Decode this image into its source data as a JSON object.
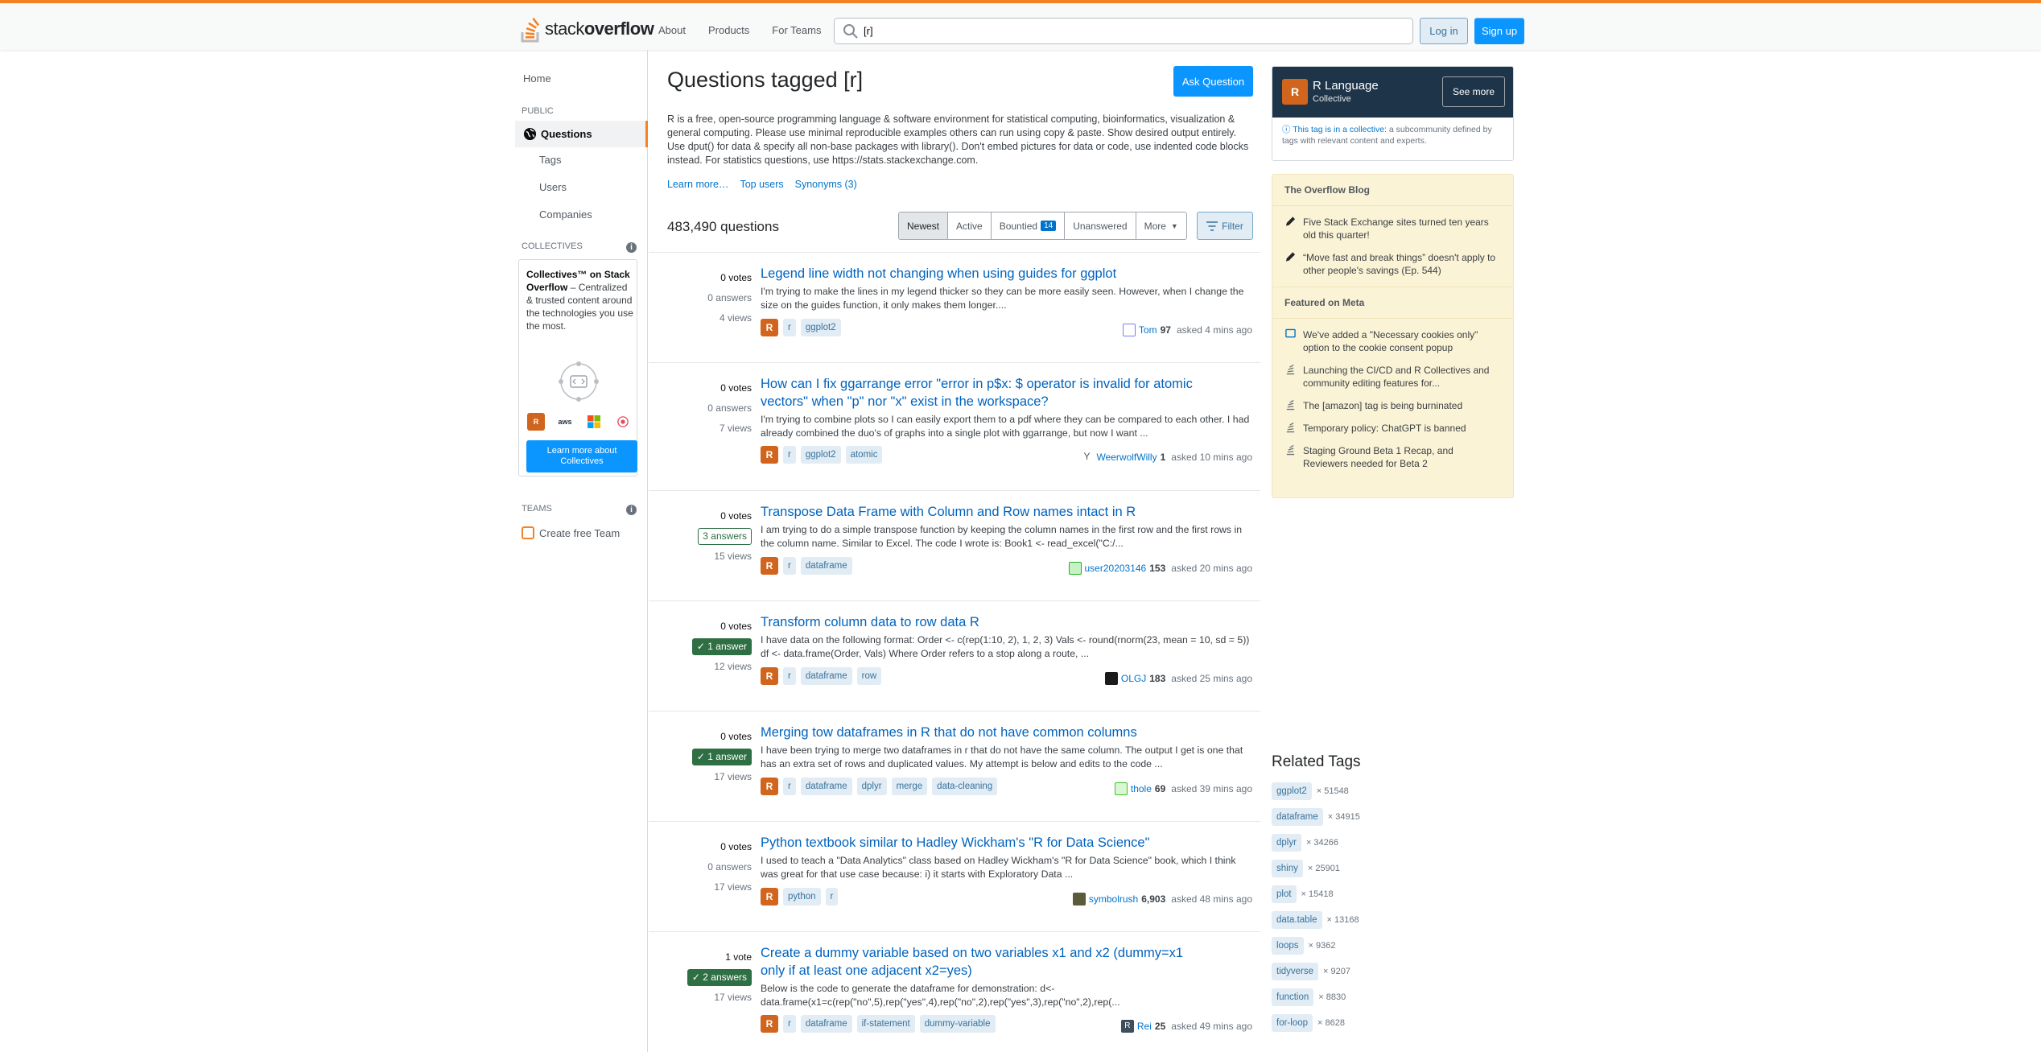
{
  "header": {
    "logo_stack": "stack",
    "logo_overflow": "overflow",
    "nav": [
      "About",
      "Products",
      "For Teams"
    ],
    "search_value": "[r]",
    "login": "Log in",
    "signup": "Sign up",
    "accent_color": "#f48225"
  },
  "leftnav": {
    "home": "Home",
    "public_label": "PUBLIC",
    "questions": "Questions",
    "tags": "Tags",
    "users": "Users",
    "companies": "Companies",
    "collectives_label": "COLLECTIVES",
    "collectives_title": "Collectives™ on Stack Overflow",
    "collectives_text": " – Centralized & trusted content around the technologies you use the most.",
    "collectives_btn": "Learn more about Collectives",
    "teams_label": "TEAMS",
    "create_team": "Create free Team"
  },
  "main": {
    "title": "Questions tagged [r]",
    "ask": "Ask Question",
    "description": "R is a free, open-source programming language & software environment for statistical computing, bioinformatics, visualization & general computing. Please use minimal reproducible examples others can run using copy & paste. Show desired output entirely. Use dput() for data & specify all non-base packages with library(). Don't embed pictures for data or code, use indented code blocks instead. For statistics questions, use https://stats.stackexchange.com.",
    "links": [
      "Learn more…",
      "Top users",
      "Synonyms (3)"
    ],
    "count": "483,490 questions",
    "sort": {
      "newest": "Newest",
      "active": "Active",
      "bountied": "Bountied",
      "bountied_count": "14",
      "unanswered": "Unanswered",
      "more": "More"
    },
    "filter": "Filter"
  },
  "questions": [
    {
      "votes": "0 votes",
      "answers": "0 answers",
      "views": "4 views",
      "title": "Legend line width not changing when using guides for ggplot",
      "excerpt": "I'm trying to make the lines in my legend thicker so they can be more easily seen. However, when I change the size on the guides function, it only makes them longer....",
      "tags": [
        "r",
        "ggplot2"
      ],
      "user": "Tom",
      "rep": "97",
      "time": "asked 4 mins ago"
    },
    {
      "votes": "0 votes",
      "answers": "0 answers",
      "views": "7 views",
      "title": "How can I fix ggarrange error \"error in p$x: $ operator is invalid for atomic vectors\" when \"p\" nor \"x\" exist in the workspace?",
      "excerpt": "I'm trying to combine plots so I can easily export them to a pdf where they can be compared to each other. I had already combined the duo's of graphs into a single plot with ggarrange, but now I want ...",
      "tags": [
        "r",
        "ggplot2",
        "atomic"
      ],
      "user": "WeerwolfWilly",
      "rep": "1",
      "time": "asked 10 mins ago"
    },
    {
      "votes": "0 votes",
      "answers": "3 answers",
      "views": "15 views",
      "title": "Transpose Data Frame with Column and Row names intact in R",
      "excerpt": "I am trying to do a simple transpose function by keeping the column names in the first row and the first rows in the column name. Similar to Excel. The code I wrote is: Book1 <- read_excel(\"C:/...",
      "tags": [
        "r",
        "dataframe"
      ],
      "user": "user20203146",
      "rep": "153",
      "time": "asked 20 mins ago"
    },
    {
      "votes": "0 votes",
      "answers": "1 answer",
      "views": "12 views",
      "title": "Transform column data to row data R",
      "excerpt": "I have data on the following format: Order <- c(rep(1:10, 2), 1, 2, 3) Vals <- round(rnorm(23, mean = 10, sd = 5)) df <- data.frame(Order, Vals) Where Order refers to a stop along a route, ...",
      "tags": [
        "r",
        "dataframe",
        "row"
      ],
      "user": "OLGJ",
      "rep": "183",
      "time": "asked 25 mins ago"
    },
    {
      "votes": "0 votes",
      "answers": "1 answer",
      "views": "17 views",
      "title": "Merging tow dataframes in R that do not have common columns",
      "excerpt": "I have been trying to merge two dataframes in r that do not have the same column. The output I get is one that has an extra set of rows and duplicated values. My attempt is below and edits to the code ...",
      "tags": [
        "r",
        "dataframe",
        "dplyr",
        "merge",
        "data-cleaning"
      ],
      "user": "thole",
      "rep": "69",
      "time": "asked 39 mins ago"
    },
    {
      "votes": "0 votes",
      "answers": "0 answers",
      "views": "17 views",
      "title": "Python textbook similar to Hadley Wickham's \"R for Data Science\"",
      "excerpt": "I used to teach a \"Data Analytics\" class based on Hadley Wickham's \"R for Data Science\" book, which I think was great for that use case because: i) it starts with Exploratory Data ...",
      "tags": [
        "python",
        "r"
      ],
      "user": "symbolrush",
      "rep": "6,903",
      "time": "asked 48 mins ago"
    },
    {
      "votes": "1 vote",
      "answers": "2 answers",
      "views": "17 views",
      "title": "Create a dummy variable based on two variables x1 and x2 (dummy=x1 only if at least one adjacent x2=yes)",
      "excerpt": "Below is the code to generate the dataframe for demonstration: d<- data.frame(x1=c(rep(\"no\",5),rep(\"yes\",4),rep(\"no\",2),rep(\"yes\",3),rep(\"no\",2),rep(...",
      "tags": [
        "r",
        "dataframe",
        "if-statement",
        "dummy-variable"
      ],
      "user": "Rei",
      "rep": "25",
      "time": "asked 49 mins ago"
    }
  ],
  "sidebar": {
    "collective_name": "R Language",
    "collective_sub": "Collective",
    "see_more": "See more",
    "note_link": "This tag is in a collective:",
    "note_text": " a subcommunity defined by tags with relevant content and experts.",
    "blog_title": "The Overflow Blog",
    "blog_items": [
      "Five Stack Exchange sites turned ten years old this quarter!",
      "“Move fast and break things” doesn't apply to other people's savings (Ep. 544)"
    ],
    "meta_title": "Featured on Meta",
    "meta_items": [
      "We've added a \"Necessary cookies only\" option to the cookie consent popup",
      "Launching the CI/CD and R Collectives and community editing features for...",
      "The [amazon] tag is being burninated",
      "Temporary policy: ChatGPT is banned",
      "Staging Ground Beta 1 Recap, and Reviewers needed for Beta 2"
    ],
    "related_title": "Related Tags",
    "related": [
      {
        "tag": "ggplot2",
        "count": "× 51548"
      },
      {
        "tag": "dataframe",
        "count": "× 34915"
      },
      {
        "tag": "dplyr",
        "count": "× 34266"
      },
      {
        "tag": "shiny",
        "count": "× 25901"
      },
      {
        "tag": "plot",
        "count": "× 15418"
      },
      {
        "tag": "data.table",
        "count": "× 13168"
      },
      {
        "tag": "loops",
        "count": "× 9362"
      },
      {
        "tag": "tidyverse",
        "count": "× 9207"
      },
      {
        "tag": "function",
        "count": "× 8830"
      },
      {
        "tag": "for-loop",
        "count": "× 8628"
      }
    ]
  }
}
